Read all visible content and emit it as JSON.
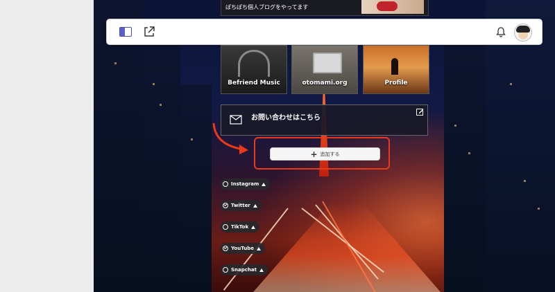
{
  "top_card": {
    "text": "ぽちぽち個人ブログをやってます"
  },
  "topbar": {
    "sidebar_icon": "sidebar-toggle-icon",
    "external_icon": "external-link-icon",
    "bell_icon": "bell-icon",
    "avatar": "avatar"
  },
  "tiles": [
    {
      "label": "Befriend Music"
    },
    {
      "label": "otomami.org"
    },
    {
      "label": "Profile"
    }
  ],
  "contact": {
    "label": "お問い合わせはこちら",
    "icon": "mail-icon",
    "edit_icon": "edit-icon"
  },
  "add_button": {
    "label": "追加する",
    "icon": "plus-icon"
  },
  "social_links": [
    {
      "label": "Instagram",
      "checked": false
    },
    {
      "label": "Twitter",
      "checked": true
    },
    {
      "label": "TikTok",
      "checked": false
    },
    {
      "label": "YouTube",
      "checked": true
    },
    {
      "label": "Snapchat",
      "checked": false
    }
  ],
  "colors": {
    "accent": "#e8391a",
    "sidebar_icon": "#5a60c8"
  }
}
